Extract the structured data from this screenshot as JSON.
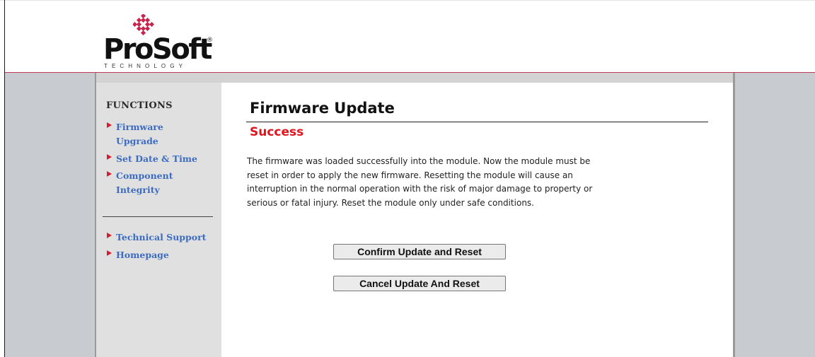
{
  "header": {
    "logo": {
      "word": "ProSoft",
      "registered": "®",
      "tagline": "TECHNOLOGY"
    }
  },
  "sidebar": {
    "title": "FUNCTIONS",
    "items": [
      {
        "label": "Firmware Upgrade"
      },
      {
        "label": "Set Date & Time"
      },
      {
        "label": "Component Integrity"
      },
      {
        "label": "Technical Support"
      },
      {
        "label": "Homepage"
      }
    ]
  },
  "main": {
    "title": "Firmware Update",
    "status": "Success",
    "message": "The firmware was loaded successfully into the module. Now the module must be reset in order to apply the new firmware. Resetting the module will cause an interruption in the normal operation with the risk of major damage to property or serious or fatal injury. Reset the module only under safe conditions.",
    "confirm_button": "Confirm Update and Reset",
    "cancel_button": "Cancel Update And Reset"
  },
  "colors": {
    "accent_red": "#e0141e",
    "link_blue": "#3c6cc1",
    "arrow_red": "#d31c2e",
    "logo_diamond": "#c8234a"
  }
}
